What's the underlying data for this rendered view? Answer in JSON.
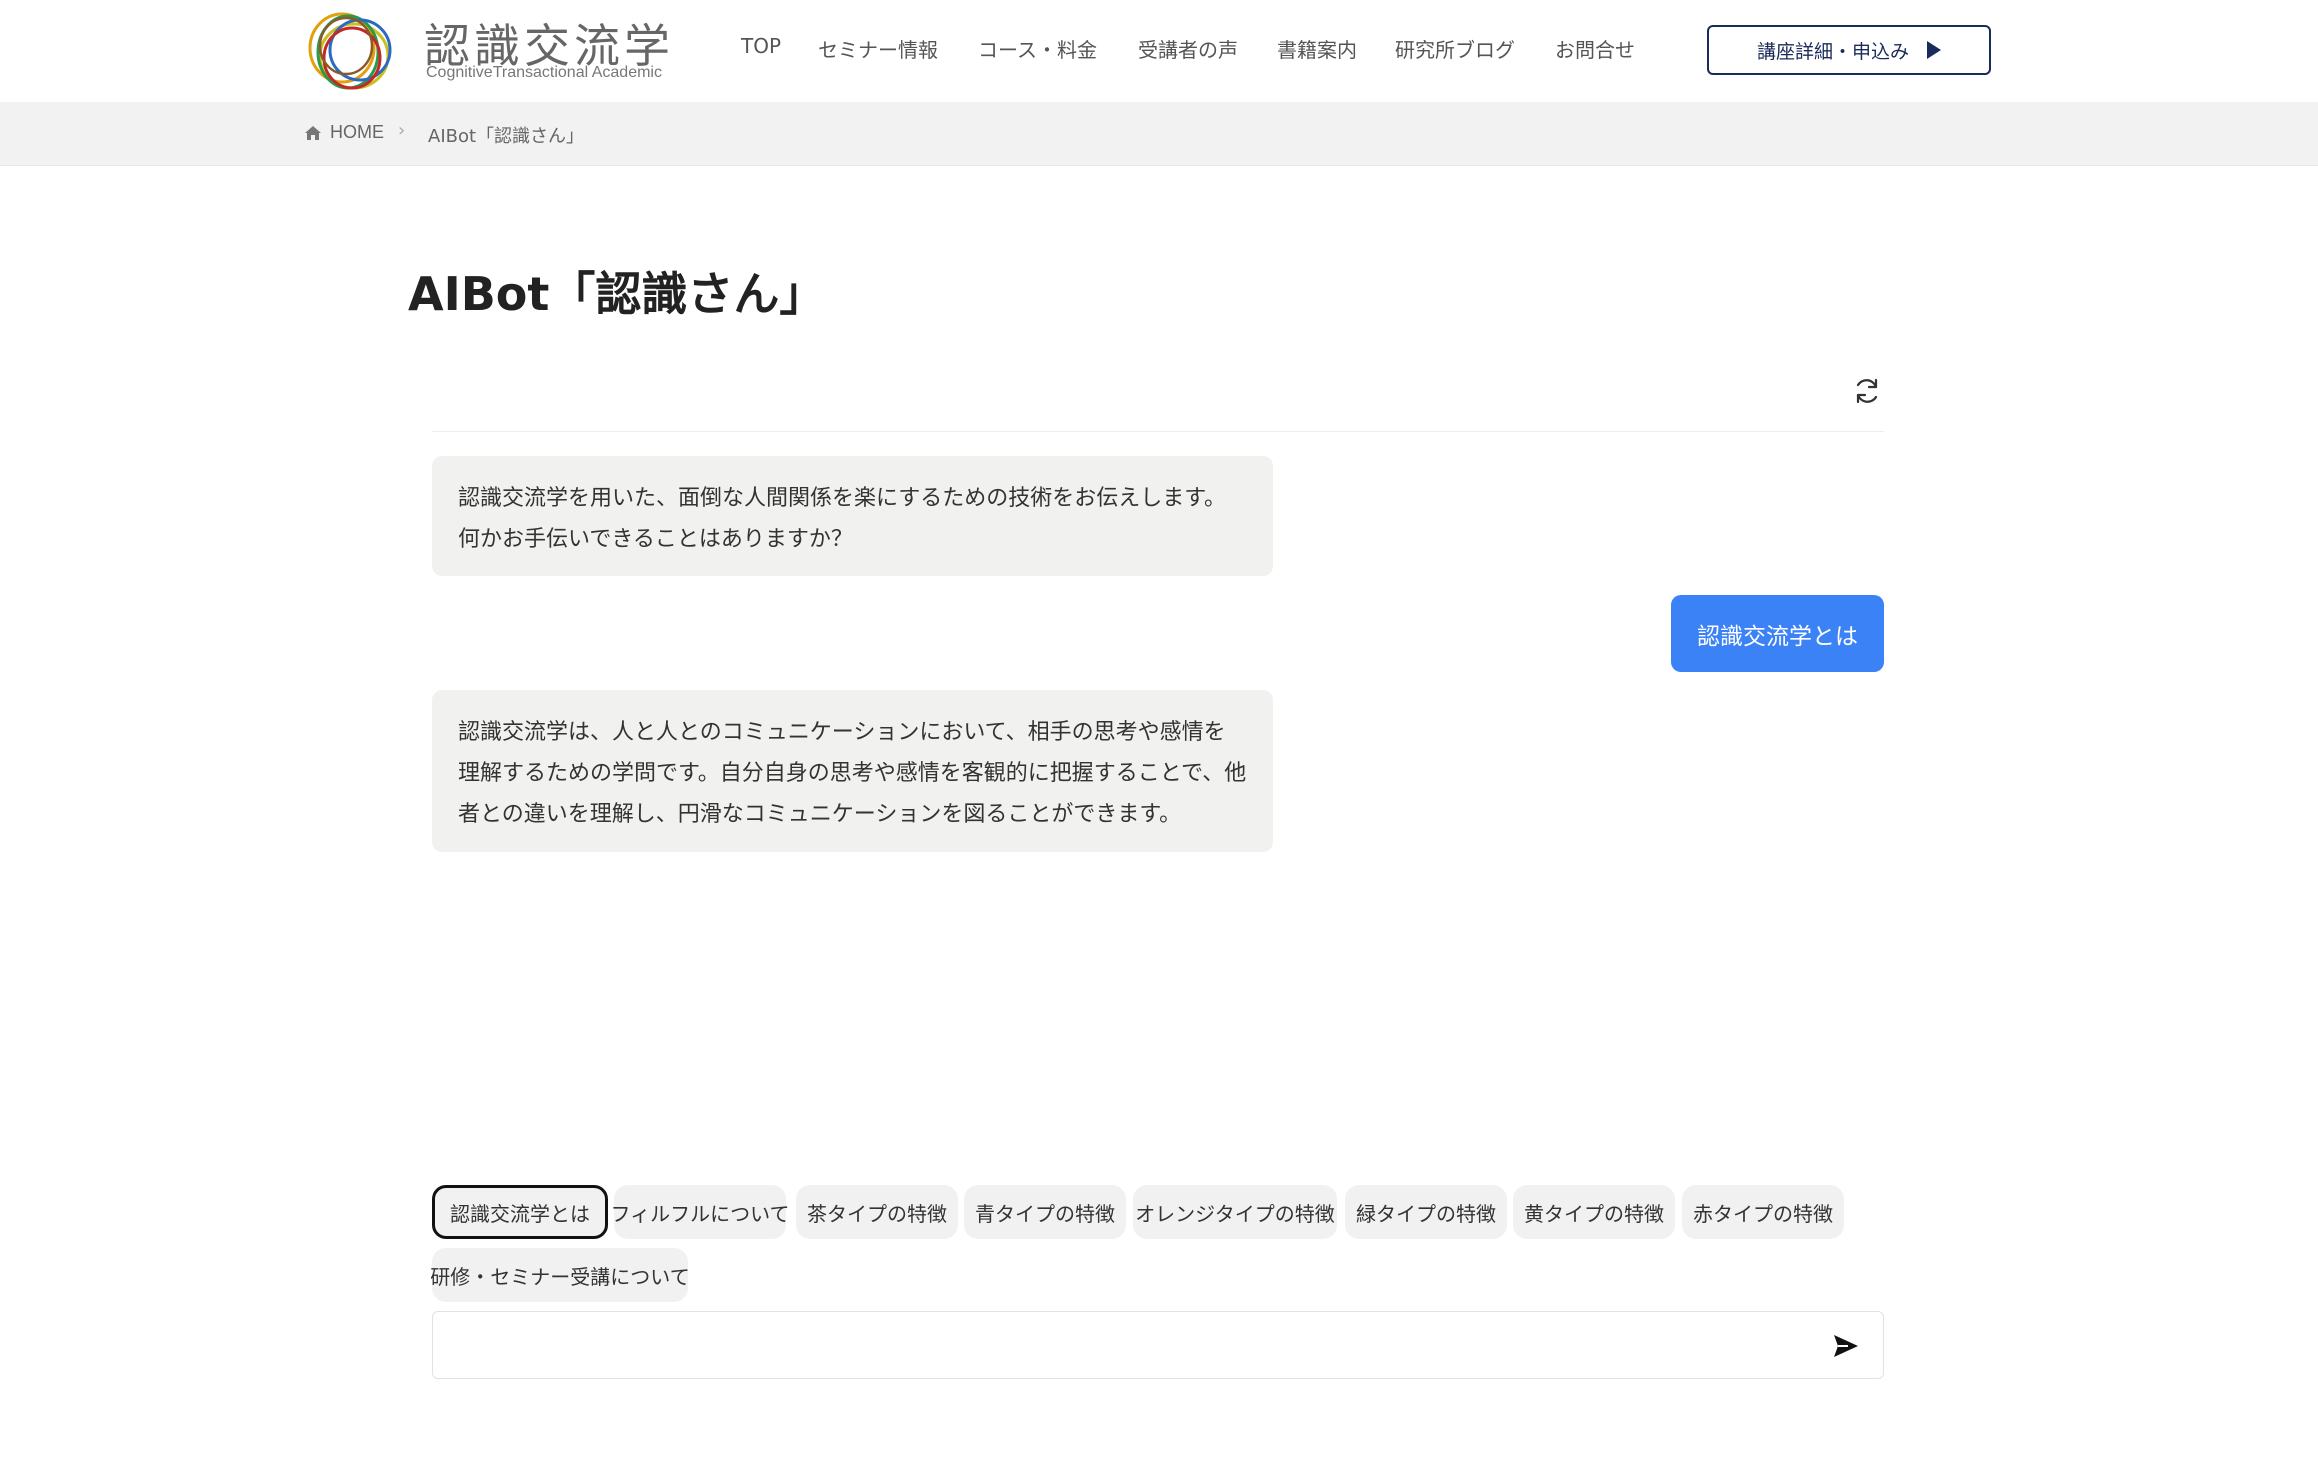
{
  "logo": {
    "title": "認識交流学",
    "subtitle": "CognitiveTransactional Academic"
  },
  "nav": {
    "items": [
      {
        "label": "TOP"
      },
      {
        "label": "セミナー情報"
      },
      {
        "label": "コース・料金"
      },
      {
        "label": "受講者の声"
      },
      {
        "label": "書籍案内"
      },
      {
        "label": "研究所ブログ"
      },
      {
        "label": "お問合せ"
      }
    ],
    "cta_label": "講座詳細・申込み"
  },
  "breadcrumb": {
    "home": "HOME",
    "current": "AIBot「認識さん」"
  },
  "page": {
    "title": "AIBot「認識さん」"
  },
  "chat": {
    "messages": [
      {
        "role": "bot",
        "text": "認識交流学を用いた、面倒な人間関係を楽にするための技術をお伝えします。何かお手伝いできることはありますか？"
      },
      {
        "role": "user",
        "text": "認識交流学とは"
      },
      {
        "role": "bot",
        "text": "認識交流学は、人と人とのコミュニケーションにおいて、相手の思考や感情を理解するための学問です。自分自身の思考や感情を客観的に把握することで、他者との違いを理解し、円滑なコミュニケーションを図ることができます。"
      }
    ],
    "suggestions": [
      "認識交流学とは",
      "フィルフルについて",
      "茶タイプの特徴",
      "青タイプの特徴",
      "オレンジタイプの特徴",
      "緑タイプの特徴",
      "黄タイプの特徴",
      "赤タイプの特徴",
      "研修・セミナー受講について"
    ],
    "input_value": "",
    "input_placeholder": ""
  },
  "colors": {
    "accent": "#3b82f6",
    "cta_border": "#1a2a5a",
    "bot_bubble": "#f1f1ef"
  },
  "icons": {
    "home": "home-icon",
    "refresh": "refresh-icon",
    "send": "send-icon",
    "cta_arrow": "play-triangle-icon"
  }
}
